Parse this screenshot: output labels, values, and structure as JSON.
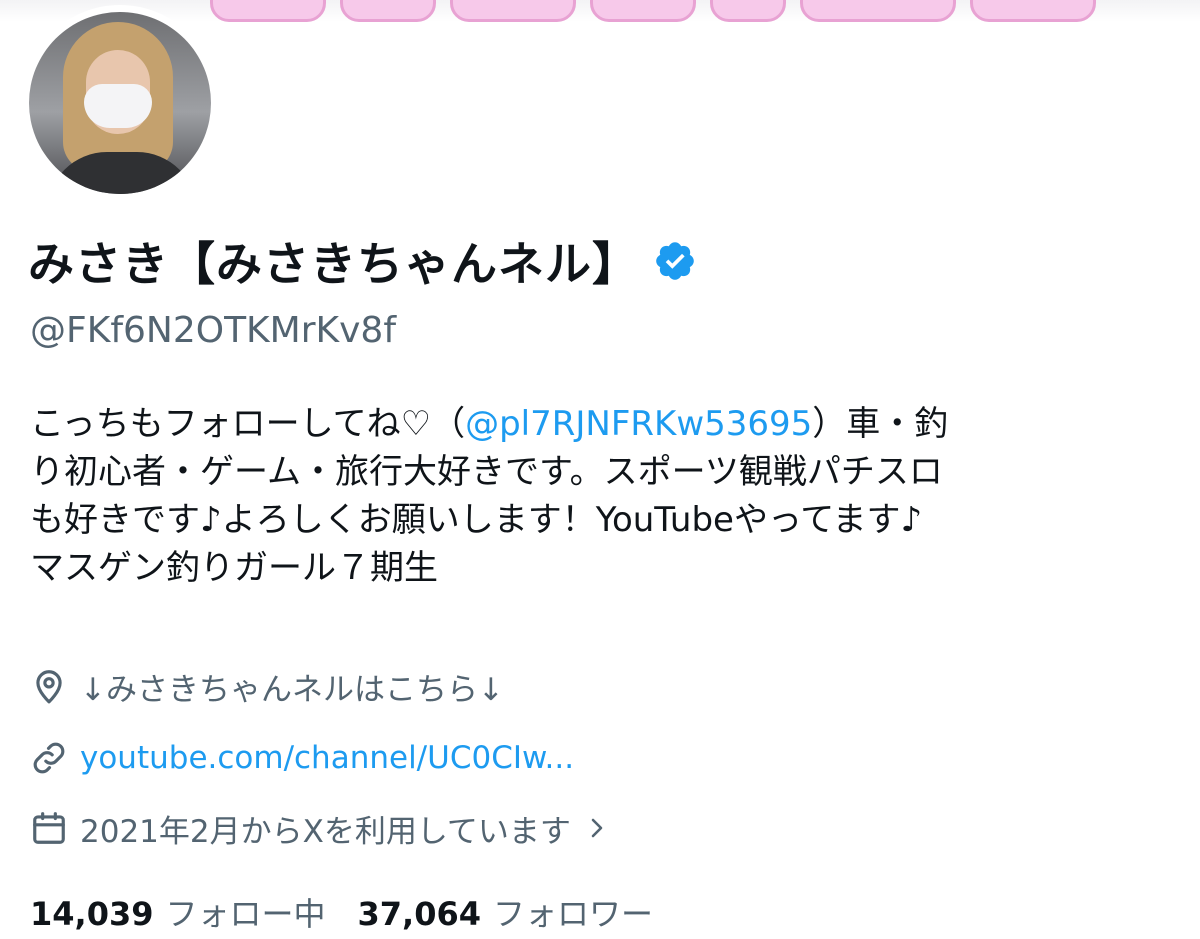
{
  "profile": {
    "display_name": "みさき【みさきちゃんネル】",
    "handle": "@FKf6N2OTKMrKv8f",
    "verified": true,
    "bio": {
      "line1_before": "こっちもフォローしてね♡（",
      "line1_mention": "@pl7RJNFRKw53695",
      "line1_after": "）車・釣",
      "line2": "り初心者・ゲーム・旅行大好きです。スポーツ観戦パチスロ",
      "line3": "も好きです♪よろしくお願いします！YouTubeやってます♪",
      "line4": "マスゲン釣りガール７期生"
    },
    "location": "↓みさきちゃんネルはこちら↓",
    "website": "youtube.com/channel/UC0CIw...",
    "joined": "2021年2月からXを利用しています",
    "following_count": "14,039",
    "following_label": "フォロー中",
    "followers_count": "37,064",
    "followers_label": "フォロワー"
  },
  "icons": {
    "verified": "verified-badge-icon",
    "location": "location-pin-icon",
    "link": "link-icon",
    "calendar": "calendar-icon",
    "chevron": "chevron-right-icon"
  },
  "colors": {
    "accent": "#1d9bf0",
    "text": "#0f1419",
    "secondary": "#536471"
  }
}
